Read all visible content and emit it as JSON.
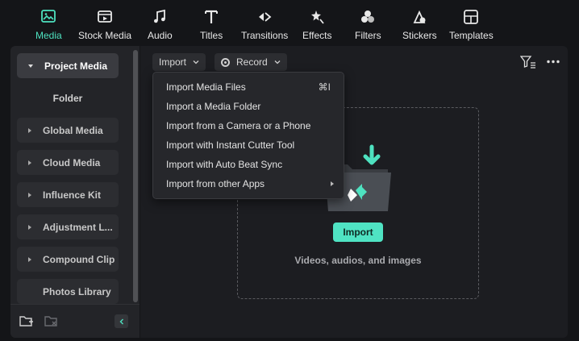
{
  "toolbar": {
    "items": [
      {
        "label": "Media",
        "icon": "media-icon",
        "active": true
      },
      {
        "label": "Stock Media",
        "icon": "stock-media-icon"
      },
      {
        "label": "Audio",
        "icon": "music-note-icon"
      },
      {
        "label": "Titles",
        "icon": "titles-icon"
      },
      {
        "label": "Transitions",
        "icon": "transitions-icon"
      },
      {
        "label": "Effects",
        "icon": "effects-icon"
      },
      {
        "label": "Filters",
        "icon": "filters-icon"
      },
      {
        "label": "Stickers",
        "icon": "stickers-icon"
      },
      {
        "label": "Templates",
        "icon": "templates-icon"
      }
    ],
    "accent_color": "#4ee2c0"
  },
  "sidebar": {
    "items": [
      {
        "label": "Project Media",
        "expanded": true,
        "selected": true
      },
      {
        "label": "Folder"
      },
      {
        "label": "Global Media"
      },
      {
        "label": "Cloud Media"
      },
      {
        "label": "Influence Kit"
      },
      {
        "label": "Adjustment L..."
      },
      {
        "label": "Compound Clip"
      },
      {
        "label": "Photos Library"
      }
    ]
  },
  "main": {
    "import_label": "Import",
    "record_label": "Record",
    "dropzone": {
      "button_label": "Import",
      "hint": "Videos, audios, and images",
      "button_color": "#4fe3c3"
    }
  },
  "import_menu": {
    "items": [
      {
        "label": "Import Media Files",
        "shortcut": "⌘I"
      },
      {
        "label": "Import a Media Folder"
      },
      {
        "label": "Import from a Camera or a Phone"
      },
      {
        "label": "Import with Instant Cutter Tool"
      },
      {
        "label": "Import with Auto Beat Sync"
      },
      {
        "label": "Import from other Apps",
        "submenu": true
      }
    ]
  }
}
